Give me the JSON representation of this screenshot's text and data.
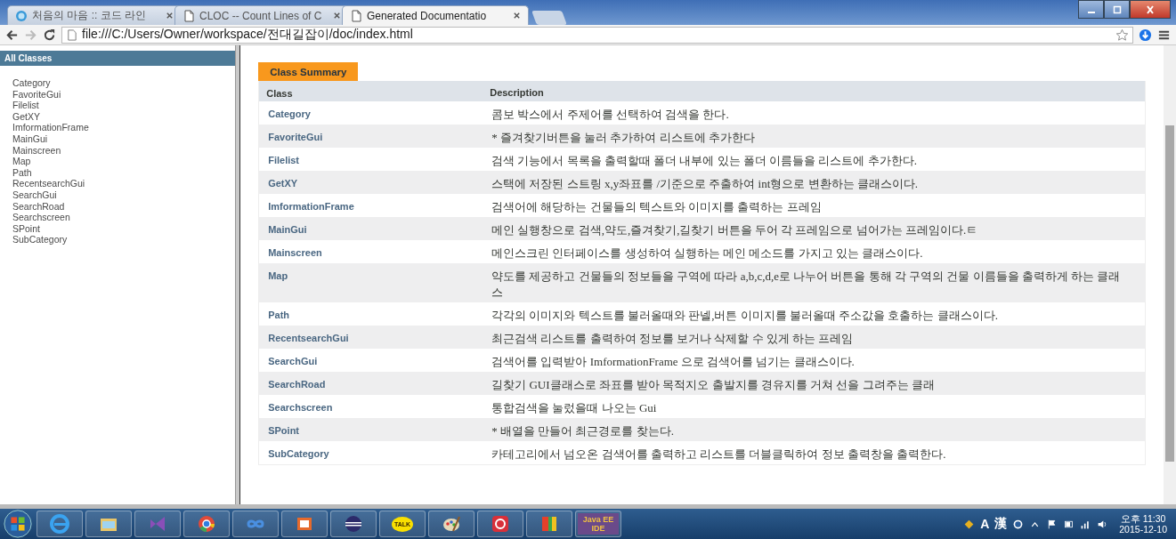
{
  "browser": {
    "tabs": [
      {
        "title": "처음의 마음 :: 코드 라인",
        "kind": "site",
        "selected": false
      },
      {
        "title": "CLOC -- Count Lines of C",
        "kind": "page",
        "selected": false
      },
      {
        "title": "Generated Documentatio",
        "kind": "page",
        "selected": true
      }
    ],
    "address": "file:///C:/Users/Owner/workspace/전대길잡이/doc/index.html"
  },
  "sidebar": {
    "title": "All Classes",
    "items": [
      "Category",
      "FavoriteGui",
      "Filelist",
      "GetXY",
      "ImformationFrame",
      "MainGui",
      "Mainscreen",
      "Map",
      "Path",
      "RecentsearchGui",
      "SearchGui",
      "SearchRoad",
      "Searchscreen",
      "SPoint",
      "SubCategory"
    ]
  },
  "summary": {
    "caption": "Class Summary",
    "columns": [
      "Class",
      "Description"
    ],
    "rows": [
      {
        "class": "Category",
        "description": "콤보 박스에서 주제어를 선택하여 검색을 한다."
      },
      {
        "class": "FavoriteGui",
        "description": "* 즐겨찾기버튼을 눌러 추가하여 리스트에 추가한다"
      },
      {
        "class": "Filelist",
        "description": "검색 기능에서 목록을 출력할때 폴더 내부에 있는 폴더 이름들을 리스트에 추가한다."
      },
      {
        "class": "GetXY",
        "description": "스택에 저장된 스트링 x,y좌표를 /기준으로 주출하여 int형으로 변환하는 클래스이다."
      },
      {
        "class": "ImformationFrame",
        "description": "검색어에 해당하는 건물들의 텍스트와 이미지를 출력하는 프레임"
      },
      {
        "class": "MainGui",
        "description": "메인 실행창으로 검색,약도,즐겨찾기,길찾기 버튼을 두어 각 프레임으로 넘어가는 프레임이다.ㅌ"
      },
      {
        "class": "Mainscreen",
        "description": "메인스크린 인터페이스를 생성하여 실행하는 메인 메소드를 가지고 있는 클래스이다."
      },
      {
        "class": "Map",
        "description": "약도를 제공하고 건물들의 정보들을 구역에 따라 a,b,c,d,e로 나누어 버튼을 통해 각 구역의 건물 이름들을 출력하게 하는 클래스"
      },
      {
        "class": "Path",
        "description": "각각의 이미지와 텍스트를 불러올때와 판넬,버튼 이미지를 불러올때 주소값을 호출하는 클래스이다."
      },
      {
        "class": "RecentsearchGui",
        "description": "최근검색 리스트를 출력하여 정보를 보거나 삭제할 수 있게 하는 프레임"
      },
      {
        "class": "SearchGui",
        "description": "검색어를 입력받아 ImformationFrame 으로 검색어를 넘기는 클래스이다."
      },
      {
        "class": "SearchRoad",
        "description": "길찾기 GUI클래스로 좌표를 받아 목적지오 출발지를 경유지를 거쳐 선을 그려주는 클래"
      },
      {
        "class": "Searchscreen",
        "description": "통합검색을 눌렀을때 나오는 Gui"
      },
      {
        "class": "SPoint",
        "description": "* 배열을 만들어 최근경로를 찾는다."
      },
      {
        "class": "SubCategory",
        "description": "카테고리에서 넘오온 검색어를 출력하고 리스트를 더블클릭하여 정보 출력창을 출력한다."
      }
    ]
  },
  "taskbar": {
    "talk_label": "TALK",
    "java_label": "Java EE IDE",
    "ime_mode": "A",
    "ime_hanja": "漢",
    "time": "오후 11:30",
    "date": "2015-12-10"
  }
}
